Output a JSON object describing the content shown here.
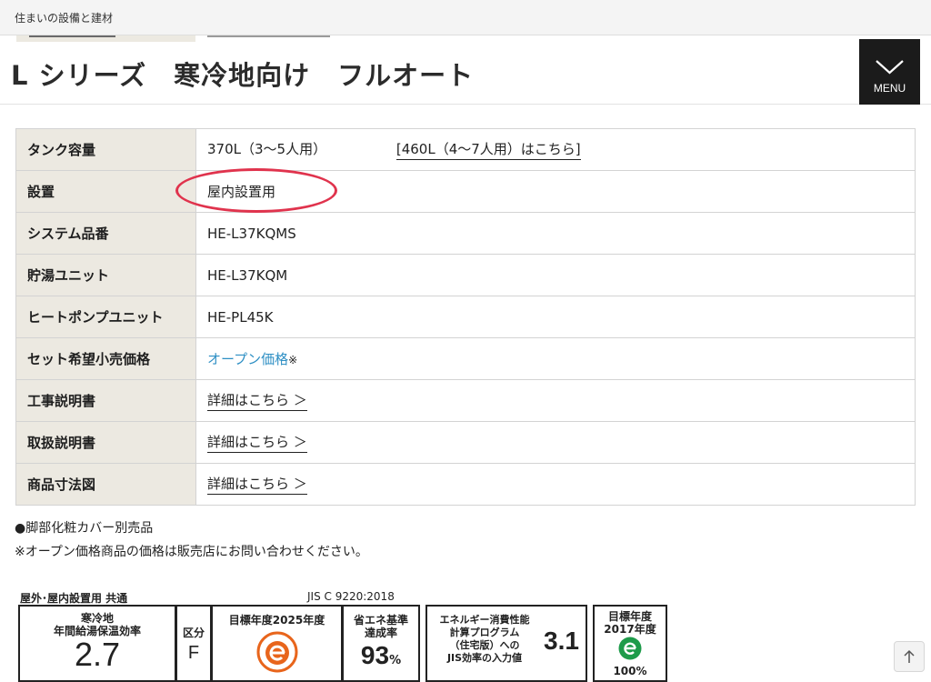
{
  "topbar": {
    "site_name": "住まいの設備と建材"
  },
  "header": {
    "title": "L シリーズ　寒冷地向け　フルオート",
    "menu_label": "MENU"
  },
  "spec_table": {
    "rows": [
      {
        "label": "タンク容量",
        "value": "370L（3〜5人用）",
        "alt_link": "[460L（4〜7人用）はこちら]"
      },
      {
        "label": "設置",
        "value": "屋内設置用"
      },
      {
        "label": "システム品番",
        "value": "HE-L37KQMS"
      },
      {
        "label": "貯湯ユニット",
        "value": "HE-L37KQM"
      },
      {
        "label": "ヒートポンプユニット",
        "value": "HE-PL45K"
      },
      {
        "label": "セット希望小売価格",
        "value": "オープン価格",
        "suffix": "※"
      },
      {
        "label": "工事説明書",
        "link": "詳細はこちら ＞"
      },
      {
        "label": "取扱説明書",
        "link": "詳細はこちら ＞"
      },
      {
        "label": "商品寸法図",
        "link": "詳細はこちら ＞"
      }
    ]
  },
  "notes": [
    "●脚部化粧カバー別売品",
    "※オープン価格商品の価格は販売店にお問い合わせください。"
  ],
  "energy_label": {
    "header_left": "屋外･屋内設置用 共通",
    "header_right": "JIS C 9220:2018",
    "efficiency": {
      "line1": "寒冷地",
      "line2": "年間給湯保温効率",
      "value": "2.7"
    },
    "category": {
      "label": "区分",
      "value": "F"
    },
    "target_2025": {
      "label": "目標年度2025年度"
    },
    "achievement": {
      "line1": "省エネ基準",
      "line2": "達成率",
      "value": "93",
      "unit": "%"
    },
    "calc_program": {
      "line1": "エネルギー消費性能",
      "line2": "計算プログラム",
      "line3": "（住宅版）への",
      "line4": "JIS効率の入力値",
      "value": "3.1"
    },
    "target_2017": {
      "line1": "目標年度",
      "line2": "2017年度",
      "value": "100%"
    }
  },
  "colors": {
    "accent_link": "#2e8fc4",
    "highlight_ring": "#e0334d",
    "label_bg": "#ece9e1",
    "menu_bg": "#1b1b1b"
  }
}
